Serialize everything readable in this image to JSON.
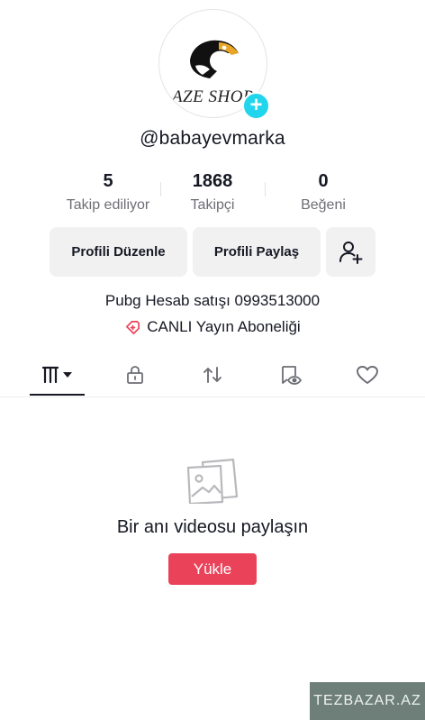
{
  "profile": {
    "avatar_text": "AZE SHOP",
    "username": "@babayevmarka",
    "stats": [
      {
        "value": "5",
        "label": "Takip ediliyor"
      },
      {
        "value": "1868",
        "label": "Takipçi"
      },
      {
        "value": "0",
        "label": "Beğeni"
      }
    ],
    "bio": "Pubg Hesab satışı 0993513000",
    "live_label": "CANLI Yayın Aboneliği"
  },
  "actions": {
    "edit_label": "Profili Düzenle",
    "share_label": "Profili Paylaş"
  },
  "tabs": [
    {
      "icon": "grid-icon",
      "active": true
    },
    {
      "icon": "lock-icon"
    },
    {
      "icon": "repost-icon"
    },
    {
      "icon": "bookmark-eye-icon"
    },
    {
      "icon": "heart-icon"
    }
  ],
  "empty_state": {
    "title": "Bir anı videosu paylaşın",
    "upload_label": "Yükle"
  },
  "watermark": "TEZBAZAR.AZ",
  "colors": {
    "accent": "#ea4359",
    "add_badge": "#20d5ec",
    "text": "#161823",
    "muted": "#6d6e75"
  }
}
